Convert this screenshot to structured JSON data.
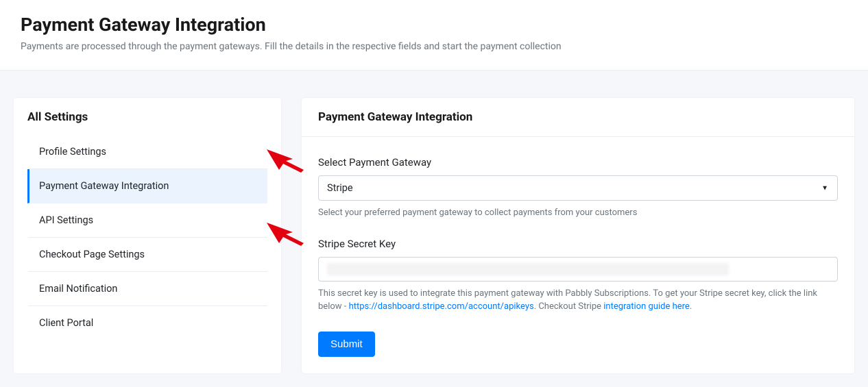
{
  "header": {
    "title": "Payment Gateway Integration",
    "subtitle": "Payments are processed through the payment gateways. Fill the details in the respective fields and start the payment collection"
  },
  "sidebar": {
    "heading": "All Settings",
    "items": [
      {
        "label": "Profile Settings"
      },
      {
        "label": "Payment Gateway Integration"
      },
      {
        "label": "API Settings"
      },
      {
        "label": "Checkout Page Settings"
      },
      {
        "label": "Email Notification"
      },
      {
        "label": "Client Portal"
      }
    ],
    "active_index": 1
  },
  "panel": {
    "title": "Payment Gateway Integration",
    "gateway_field": {
      "label": "Select Payment Gateway",
      "selected": "Stripe",
      "help": "Select your preferred payment gateway to collect payments from your customers"
    },
    "secret_field": {
      "label": "Stripe Secret Key",
      "value": "",
      "help_pre": "This secret key is used to integrate this payment gateway with Pabbly Subscriptions. To get your Stripe secret key, click the link below - ",
      "link1_text": "https://dashboard.stripe.com/account/apikeys",
      "help_mid": ". Checkout Stripe ",
      "link2_text": "integration guide here",
      "help_post": "."
    },
    "submit_label": "Submit"
  }
}
